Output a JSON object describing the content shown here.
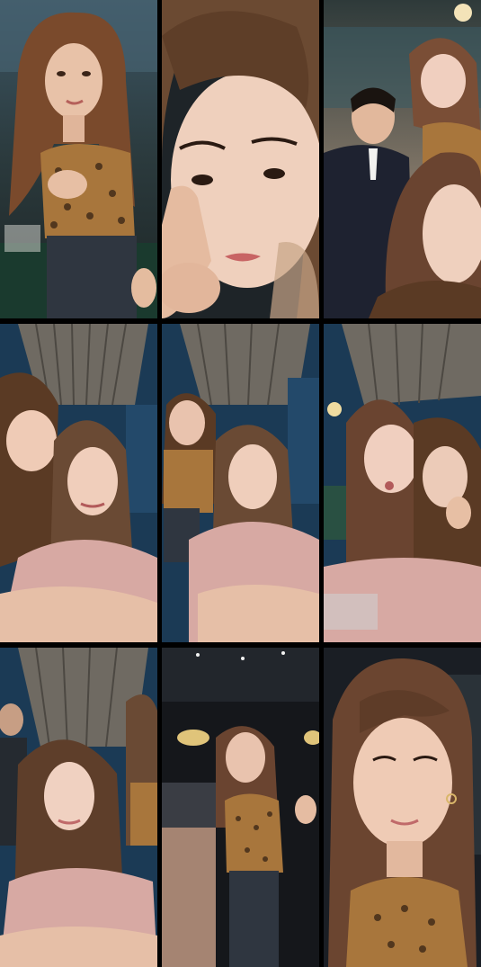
{
  "collage": {
    "rows": 3,
    "columns": 3,
    "tiles": [
      {
        "id": "tile-1",
        "scene": "restaurant-night",
        "subjects": 1
      },
      {
        "id": "tile-2",
        "scene": "closeup-selfie",
        "subjects": 1
      },
      {
        "id": "tile-3",
        "scene": "restaurant-group",
        "subjects": 3
      },
      {
        "id": "tile-4",
        "scene": "slatted-ceiling-duo",
        "subjects": 2
      },
      {
        "id": "tile-5",
        "scene": "slatted-ceiling-duo",
        "subjects": 2
      },
      {
        "id": "tile-6",
        "scene": "slatted-ceiling-duo",
        "subjects": 2
      },
      {
        "id": "tile-7",
        "scene": "slatted-ceiling-selfie",
        "subjects": 2
      },
      {
        "id": "tile-8",
        "scene": "restaurant-standing",
        "subjects": 1
      },
      {
        "id": "tile-9",
        "scene": "closeup-selfie",
        "subjects": 1
      }
    ]
  },
  "colors": {
    "background": "#000000",
    "skin": "#e9c3ae",
    "hair": "#5a3a24",
    "leopard": "#a8763c",
    "denim": "#2f3640",
    "pink_top": "#d7a9a3",
    "ceiling": "#6f6a62",
    "night_window": "#1b3a55"
  }
}
